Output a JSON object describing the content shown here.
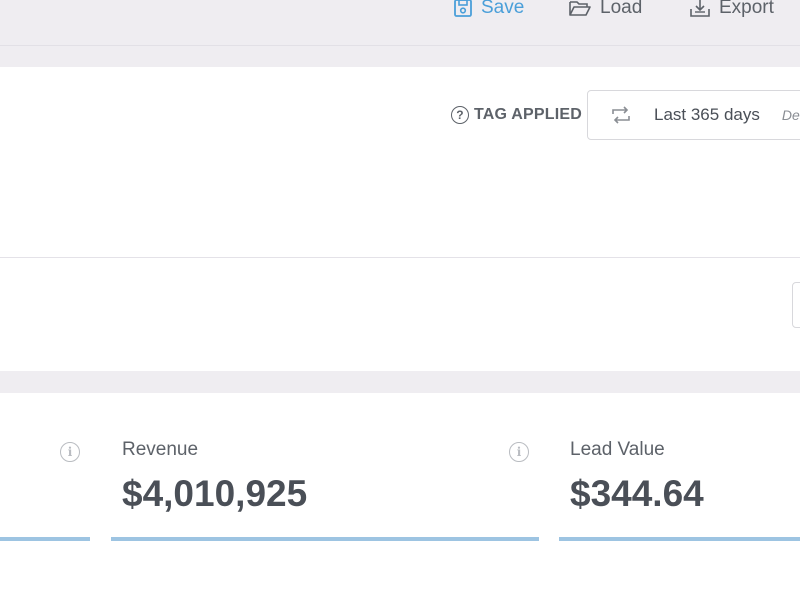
{
  "toolbar": {
    "save_label": "Save",
    "load_label": "Load",
    "export_label": "Export"
  },
  "filters": {
    "tag_applied_label": "TAG APPLIED",
    "date_range_label": "Last 365 days",
    "date_range_extra": "De"
  },
  "metrics": [
    {
      "label": "Revenue",
      "value": "$4,010,925"
    },
    {
      "label": "Lead Value",
      "value": "$344.64"
    }
  ],
  "colors": {
    "accent": "#4a9fd9",
    "metric_bar": "#9dc4e2",
    "background": "#efedf1"
  }
}
